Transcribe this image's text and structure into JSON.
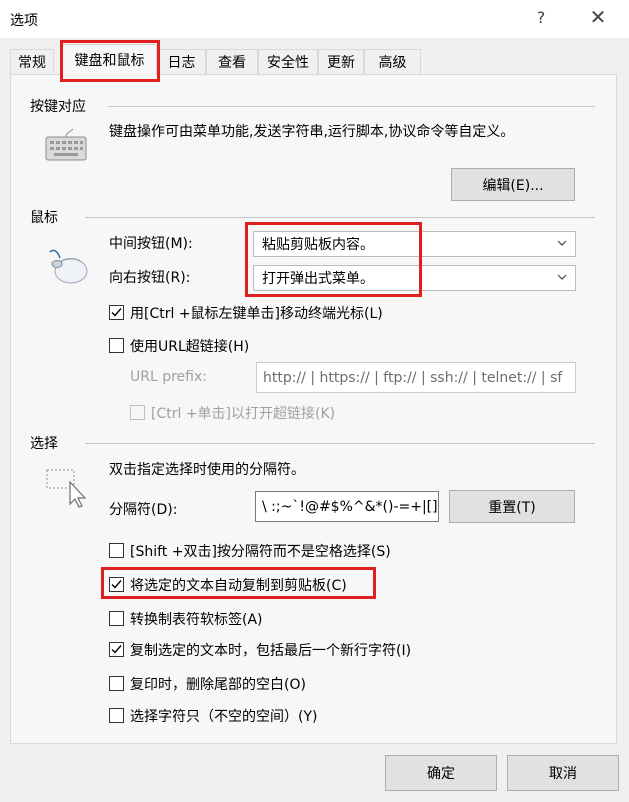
{
  "window": {
    "title": "选项",
    "help_glyph": "?",
    "close_glyph": "✕"
  },
  "tabs": [
    {
      "label": "常规"
    },
    {
      "label": "键盘和鼠标"
    },
    {
      "label": "日志"
    },
    {
      "label": "查看"
    },
    {
      "label": "安全性"
    },
    {
      "label": "更新"
    },
    {
      "label": "高级"
    }
  ],
  "keymap": {
    "heading": "按键对应",
    "description": "键盘操作可由菜单功能,发送字符串,运行脚本,协议命令等自定义。",
    "edit_button": "编辑(E)..."
  },
  "mouse": {
    "heading": "鼠标",
    "middle_label": "中间按钮(M):",
    "middle_value": "粘贴剪贴板内容。",
    "right_label": "向右按钮(R):",
    "right_value": "打开弹出式菜单。",
    "ctrl_click_move": "用[Ctrl +鼠标左键单击]移动终端光标(L)",
    "use_url": "使用URL超链接(H)",
    "url_prefix_label": "URL prefix:",
    "url_prefix_value": "http:// | https:// | ftp:// | ssh:// | telnet:// | sf",
    "ctrl_click_open": "[Ctrl +单击]以打开超链接(K)"
  },
  "selection": {
    "heading": "选择",
    "description": "双击指定选择时使用的分隔符。",
    "delim_label": "分隔符(D):",
    "delim_value": "\\ :;~`!@#$%^&*()-=+|[]{",
    "reset_button": "重置(T)",
    "options": [
      {
        "label": "[Shift +双击]按分隔符而不是空格选择(S)",
        "checked": false
      },
      {
        "label": "将选定的文本自动复制到剪贴板(C)",
        "checked": true
      },
      {
        "label": "转换制表符软标签(A)",
        "checked": false
      },
      {
        "label": "复制选定的文本时，包括最后一个新行字符(I)",
        "checked": true
      },
      {
        "label": "复印时，删除尾部的空白(O)",
        "checked": false
      },
      {
        "label": "选择字符只（不空的空间）(Y)",
        "checked": false
      }
    ]
  },
  "footer": {
    "ok": "确定",
    "cancel": "取消"
  },
  "colors": {
    "highlight": "#e02020",
    "face": "#f0f0f0",
    "panel": "#f7f7f7"
  }
}
